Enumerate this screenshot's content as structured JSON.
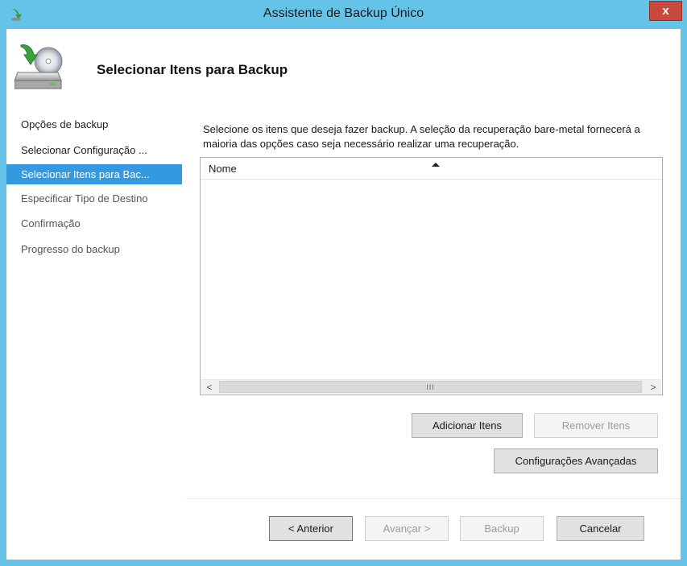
{
  "window": {
    "title": "Assistente de Backup Único",
    "close_label": "x"
  },
  "header": {
    "title": "Selecionar Itens para Backup"
  },
  "nav": {
    "items": [
      {
        "label": "Opções de backup",
        "state": "done"
      },
      {
        "label": "Selecionar Configuração ...",
        "state": "done"
      },
      {
        "label": "Selecionar Itens para Bac...",
        "state": "active"
      },
      {
        "label": "Especificar Tipo de Destino",
        "state": "pending"
      },
      {
        "label": "Confirmação",
        "state": "pending"
      },
      {
        "label": "Progresso do backup",
        "state": "pending"
      }
    ]
  },
  "main": {
    "description": "Selecione os itens que deseja fazer backup. A seleção da recuperação bare-metal fornecerá a maioria das opções caso seja necessário realizar uma recuperação.",
    "list": {
      "column_header": "Nome",
      "scroll_left": "<",
      "scroll_right": ">",
      "scroll_grip": "III"
    },
    "add_items_label": "Adicionar Itens",
    "remove_items_label": "Remover Itens",
    "advanced_settings_label": "Configurações Avançadas"
  },
  "footer": {
    "previous_label": "< Anterior",
    "next_label": "Avançar >",
    "backup_label": "Backup",
    "cancel_label": "Cancelar"
  },
  "colors": {
    "titlebar": "#66c3e8",
    "close_button": "#c9483c",
    "nav_active": "#3399e0"
  }
}
